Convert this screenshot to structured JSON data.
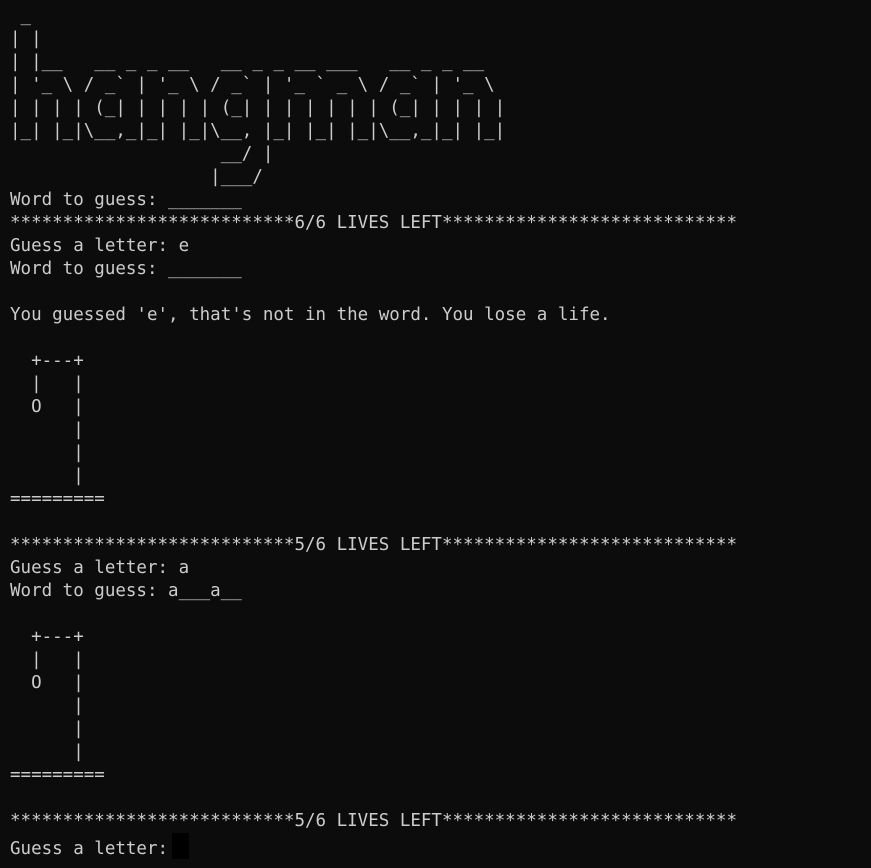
{
  "banner": [
    " _",
    "| |",
    "| |__   __ _ _ __   __ _ _ __ ___   __ _ _ __",
    "| '_ \\ / _` | '_ \\ / _` | '_ ` _ \\ / _` | '_ \\",
    "| | | | (_| | | | | (_| | | | | | | (_| | | | |",
    "|_| |_|\\__,_|_| |_|\\__, |_| |_| |_|\\__,_|_| |_|",
    "                    __/ |",
    "                   |___/"
  ],
  "intro_word_line": "Word to guess: _______",
  "round1": {
    "lives_banner": "***************************6/6 LIVES LEFT****************************",
    "guess_line": "Guess a letter: e",
    "word_line": "Word to guess: _______",
    "message": "You guessed 'e', that's not in the word. You lose a life."
  },
  "gallows1": [
    "  +---+",
    "  |   |",
    "  O   |",
    "      |",
    "      |",
    "      |",
    "========="
  ],
  "round2": {
    "lives_banner": "***************************5/6 LIVES LEFT****************************",
    "guess_line": "Guess a letter: a",
    "word_line": "Word to guess: a___a__"
  },
  "gallows2": [
    "  +---+",
    "  |   |",
    "  O   |",
    "      |",
    "      |",
    "      |",
    "========="
  ],
  "round3": {
    "lives_banner": "***************************5/6 LIVES LEFT****************************",
    "prompt": "Guess a letter:"
  }
}
